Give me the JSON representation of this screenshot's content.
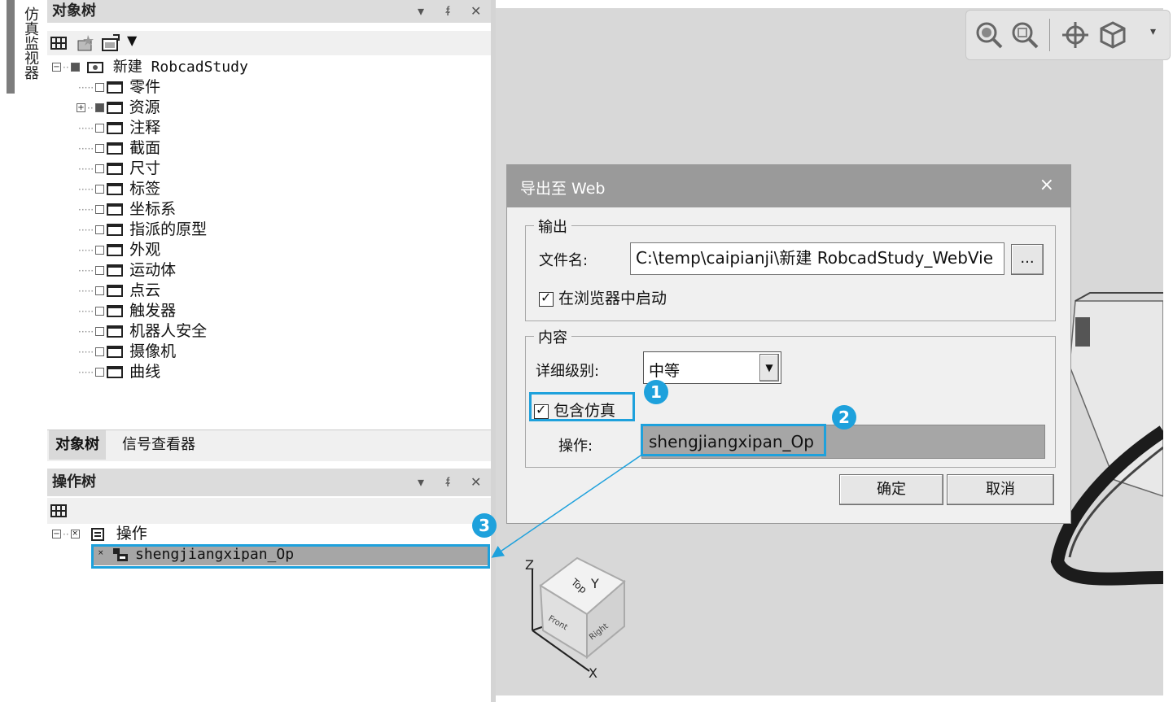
{
  "side_tab": {
    "label": "仿真监视器"
  },
  "object_tree": {
    "title": "对象树",
    "controls": {
      "dropdown": "▾",
      "pin": "ᵮ",
      "close": "✕"
    },
    "root": "新建 RobcadStudy",
    "items": [
      {
        "label": "零件",
        "expandable": false,
        "filled": false
      },
      {
        "label": "资源",
        "expandable": true,
        "filled": true
      },
      {
        "label": "注释",
        "expandable": false,
        "filled": false
      },
      {
        "label": "截面",
        "expandable": false,
        "filled": false
      },
      {
        "label": "尺寸",
        "expandable": false,
        "filled": false
      },
      {
        "label": "标签",
        "expandable": false,
        "filled": false
      },
      {
        "label": "坐标系",
        "expandable": false,
        "filled": false
      },
      {
        "label": "指派的原型",
        "expandable": false,
        "filled": false
      },
      {
        "label": "外观",
        "expandable": false,
        "filled": false
      },
      {
        "label": "运动体",
        "expandable": false,
        "filled": false
      },
      {
        "label": "点云",
        "expandable": false,
        "filled": false
      },
      {
        "label": "触发器",
        "expandable": false,
        "filled": false
      },
      {
        "label": "机器人安全",
        "expandable": false,
        "filled": false
      },
      {
        "label": "摄像机",
        "expandable": false,
        "filled": false
      },
      {
        "label": "曲线",
        "expandable": false,
        "filled": false
      }
    ]
  },
  "tabs": [
    "对象树",
    "信号查看器"
  ],
  "operation_tree": {
    "title": "操作树",
    "root": "操作",
    "child": "shengjiangxipan_Op"
  },
  "dialog": {
    "title": "导出至 Web",
    "close": "×",
    "output_group": "输出",
    "filename_label": "文件名:",
    "filename_value": "C:\\temp\\caipianji\\新建 RobcadStudy_WebVie",
    "browse_label": "...",
    "launch_label": "在浏览器中启动",
    "content_group": "内容",
    "detail_label": "详细级别:",
    "detail_value": "中等",
    "include_sim_label": "包含仿真",
    "operation_label": "操作:",
    "operation_value": "shengjiangxipan_Op",
    "ok_label": "确定",
    "cancel_label": "取消"
  },
  "callouts": [
    "1",
    "2",
    "3"
  ],
  "cube": {
    "face_top": "Top",
    "face_front": "Front",
    "face_right": "Right",
    "axis_x": "X",
    "axis_y": "Y",
    "axis_z": "Z"
  },
  "colors": {
    "callout": "#1ea1dc",
    "dialog_title": "#9a9a9a",
    "viewport": "#d8d8d8"
  }
}
